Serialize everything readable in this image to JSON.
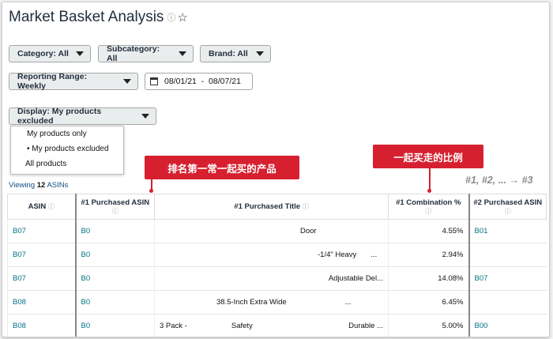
{
  "page": {
    "title": "Market Basket Analysis",
    "info_icon": "info-icon",
    "star_icon": "star-icon"
  },
  "filters": {
    "category": "Category: All",
    "subcategory": "Subcategory: All",
    "brand": "Brand: All",
    "reporting_range": "Reporting Range: Weekly",
    "date_range": "08/01/21  -  08/07/21",
    "display": "Display: My products excluded",
    "display_options": [
      "My products only",
      "• My products excluded",
      "All products"
    ]
  },
  "annotations": {
    "callout_left": "排名第一常一起买的产品",
    "callout_right": "一起买走的比例",
    "next_columns": "#1, #2, ... → #3"
  },
  "summary": {
    "viewing_prefix": "Viewing ",
    "viewing_count": "12",
    "viewing_suffix": " ASINs"
  },
  "table": {
    "headers": [
      "ASIN",
      "#1 Purchased ASIN",
      "#1 Purchased Title",
      "#1 Combination %",
      "#2 Purchased ASIN"
    ],
    "rows": [
      {
        "asin": "B07",
        "p1_asin": "B0",
        "p1_title_a": "Door",
        "p1_title_b": "",
        "p1_title_c": "",
        "combo": "4.55%",
        "p2_asin": "B01"
      },
      {
        "asin": "B07",
        "p1_asin": "B0",
        "p1_title_a": "-1/4\" Heavy",
        "p1_title_b": "...",
        "p1_title_c": "",
        "combo": "2.94%",
        "p2_asin": ""
      },
      {
        "asin": "B07",
        "p1_asin": "B0",
        "p1_title_a": "Adjustable Del...",
        "p1_title_b": "",
        "p1_title_c": "",
        "combo": "14.08%",
        "p2_asin": "B07"
      },
      {
        "asin": "B08",
        "p1_asin": "B0",
        "p1_title_a": "38.5-Inch Extra Wide",
        "p1_title_b": "...",
        "p1_title_c": "",
        "combo": "6.45%",
        "p2_asin": ""
      },
      {
        "asin": "B08",
        "p1_asin": "B0",
        "p1_title_a": "3 Pack -",
        "p1_title_b": "Safety",
        "p1_title_c": "Durable ...",
        "combo": "5.00%",
        "p2_asin": "B00"
      }
    ]
  },
  "colors": {
    "callout": "#d6202f",
    "link": "#007185",
    "dropdown_bg": "#eaeded"
  }
}
